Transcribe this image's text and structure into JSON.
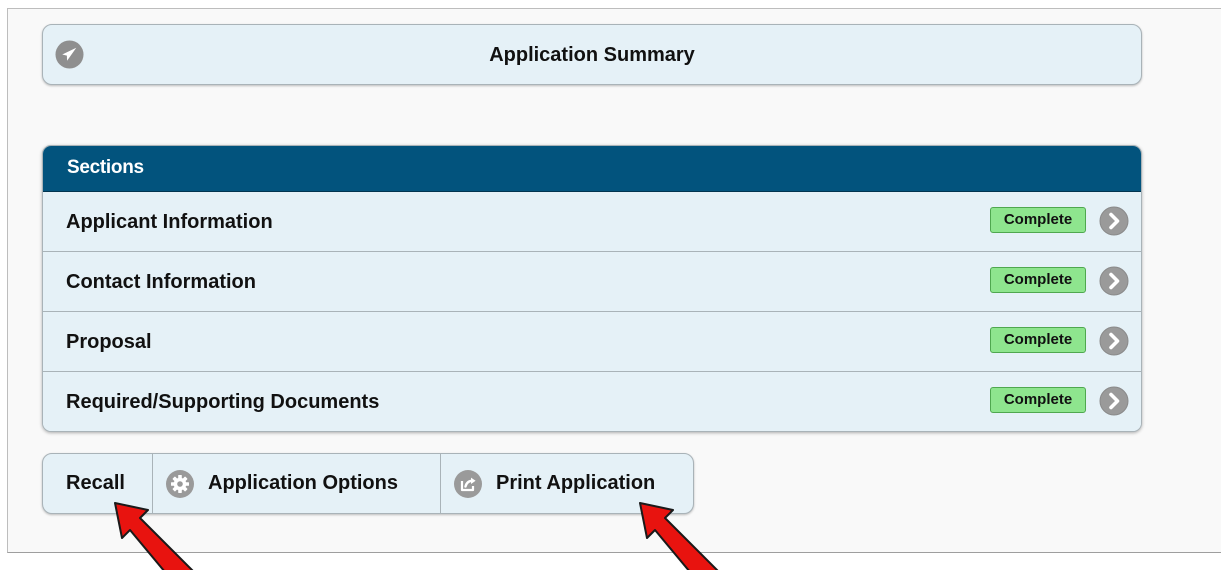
{
  "summary": {
    "title": "Application Summary",
    "icon": "navigation-arrow-icon"
  },
  "sections": {
    "header": "Sections",
    "items": [
      {
        "label": "Applicant Information",
        "status": "Complete"
      },
      {
        "label": "Contact Information",
        "status": "Complete"
      },
      {
        "label": "Proposal",
        "status": "Complete"
      },
      {
        "label": "Required/Supporting Documents",
        "status": "Complete"
      }
    ]
  },
  "actions": {
    "recall": "Recall",
    "options": "Application Options",
    "print": "Print Application"
  },
  "colors": {
    "header_bg": "#02537d",
    "panel_bg": "#e5f1f7",
    "badge_bg": "#8ee58e",
    "icon_gray": "#9a9a9a",
    "annotation_arrow": "#e8130f"
  }
}
